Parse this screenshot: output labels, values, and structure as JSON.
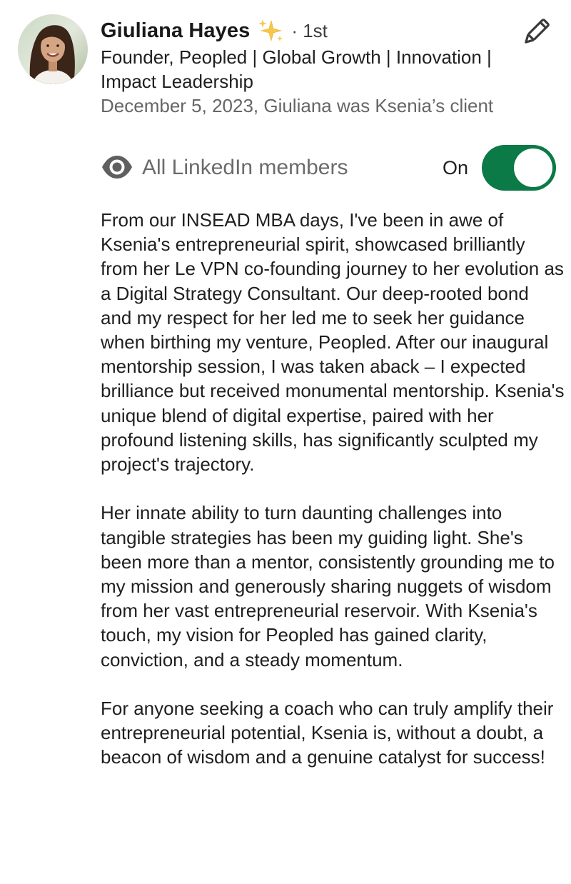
{
  "recommendation": {
    "author_name": "Giuliana Hayes",
    "connection_degree": "· 1st",
    "headline": "Founder, Peopled | Global Growth | Innovation | Impact Leadership",
    "meta": "December 5, 2023, Giuliana was Ksenia’s client",
    "icons": {
      "author_badge": "sparkles-icon",
      "edit": "pencil-icon",
      "visibility": "eye-icon"
    }
  },
  "visibility": {
    "label": "All LinkedIn members",
    "toggle_state": "On",
    "toggle_on": true,
    "toggle_color": "#0b7a46"
  },
  "body": {
    "paragraphs": [
      "From our INSEAD MBA days, I've been in awe of Ksenia's entrepreneurial spirit, showcased brilliantly from her Le VPN co-founding journey to her evolution as a Digital Strategy Consultant. Our deep-rooted bond and my respect for her led me to seek her guidance when birthing my venture, Peopled. After our inaugural mentorship session, I was taken aback – I expected brilliance but received monumental mentorship. Ksenia's unique blend of digital expertise, paired with her profound listening skills, has significantly sculpted my project's trajectory.",
      "Her innate ability to turn daunting challenges into tangible strategies has been my guiding light. She's been more than a mentor, consistently grounding me to my mission and generously sharing nuggets of wisdom from her vast entrepreneurial reservoir. With Ksenia's touch, my vision for Peopled has gained clarity, conviction, and a steady momentum.",
      "For anyone seeking a coach who can truly amplify their entrepreneurial potential, Ksenia is, without a doubt, a beacon of wisdom and a genuine catalyst for success!"
    ]
  }
}
